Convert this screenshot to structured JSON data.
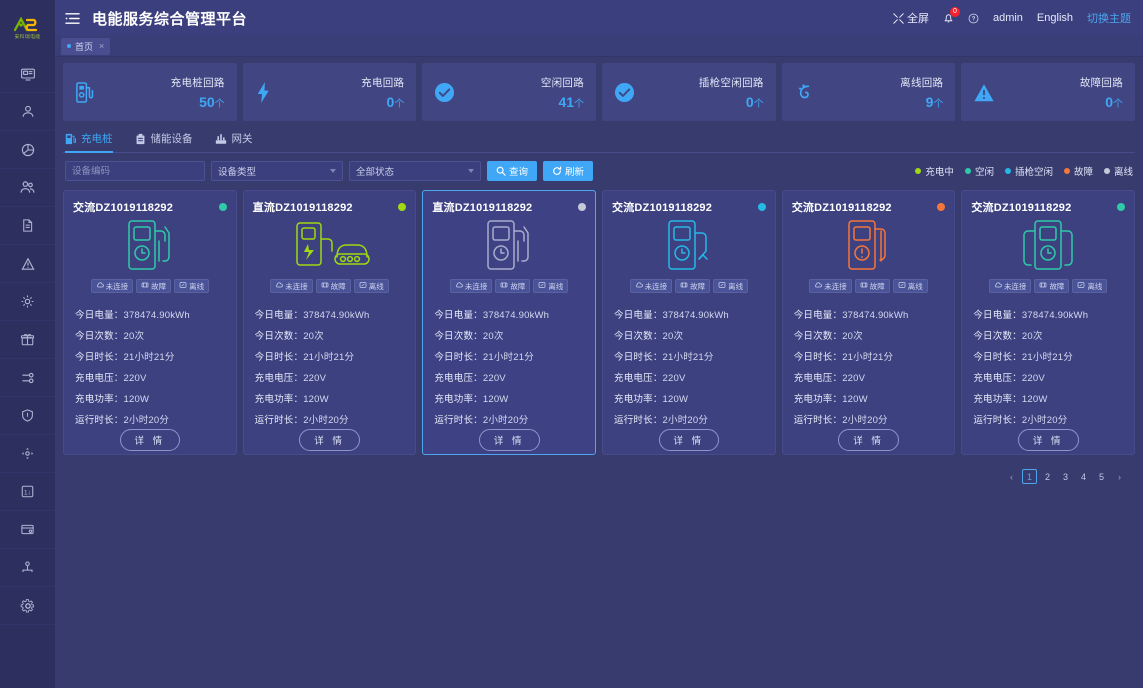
{
  "brand": {
    "logo_text": "AES",
    "logo_sub": "安科瑞电能",
    "accent": "#3fa7f5"
  },
  "header": {
    "menu_toggle_icon": "hamburger-icon",
    "title": "电能服务综合管理平台",
    "fullscreen_label": "全屏",
    "fullscreen_icon": "fullscreen-icon",
    "bell_icon": "bell-icon",
    "notification_count": "0",
    "help_icon": "help-circle-icon",
    "user": "admin",
    "language": "English",
    "theme_toggle": "切换主题"
  },
  "tabstrip": {
    "tabs": [
      {
        "label": "首页",
        "closable": true
      }
    ]
  },
  "stats": [
    {
      "icon": "charging-pile-icon",
      "label": "充电桩回路",
      "value": "50",
      "unit": "个"
    },
    {
      "icon": "bolt-icon",
      "label": "充电回路",
      "value": "0",
      "unit": "个"
    },
    {
      "icon": "check-circle-icon",
      "label": "空闲回路",
      "value": "41",
      "unit": "个"
    },
    {
      "icon": "check-circle-icon",
      "label": "插枪空闲回路",
      "value": "0",
      "unit": "个"
    },
    {
      "icon": "plug-icon",
      "label": "离线回路",
      "value": "9",
      "unit": "个"
    },
    {
      "icon": "warning-triangle-icon",
      "label": "故障回路",
      "value": "0",
      "unit": "个"
    }
  ],
  "tabs": [
    {
      "label": "充电桩",
      "icon": "charging-pile-icon",
      "active": true
    },
    {
      "label": "储能设备",
      "icon": "battery-icon",
      "active": false
    },
    {
      "label": "网关",
      "icon": "gateway-icon",
      "active": false
    }
  ],
  "filters": {
    "device_code_placeholder": "设备编码",
    "device_code_value": "",
    "device_type_value": "设备类型",
    "status_value": "全部状态",
    "search_label": "查询",
    "search_icon": "search-icon",
    "refresh_label": "刷新",
    "refresh_icon": "refresh-icon"
  },
  "legend": [
    {
      "label": "充电中",
      "color": "#a0d911"
    },
    {
      "label": "空闲",
      "color": "#2fcaa8"
    },
    {
      "label": "插枪空闲",
      "color": "#25b9e6"
    },
    {
      "label": "故障",
      "color": "#f5763b"
    },
    {
      "label": "离线",
      "color": "#c6cad8"
    }
  ],
  "card_field_labels": {
    "energy": "今日电量：",
    "count": "今日次数：",
    "duration": "今日时长：",
    "voltage": "充电电压：",
    "power": "充电功率：",
    "runtime": "运行时长："
  },
  "card_tags": [
    {
      "label": "未连接",
      "icon": "cloud-icon"
    },
    {
      "label": "故障",
      "icon": "gauge-icon"
    },
    {
      "label": "离线",
      "icon": "signal-off-icon"
    }
  ],
  "card_detail_label": "详 情",
  "cards": [
    {
      "title": "交流DZ1019118292",
      "type": "ac",
      "status_color": "#2fcaa8",
      "icon": "pile-ac-icon",
      "icon_color": "#2fcaa8",
      "energy": "378474.90kWh",
      "count": "20次",
      "duration": "21小时21分",
      "voltage": "220V",
      "power": "120W",
      "runtime": "2小时20分",
      "selected": false
    },
    {
      "title": "直流DZ1019118292",
      "type": "dc",
      "status_color": "#a0d911",
      "icon": "pile-dc-car-icon",
      "icon_color": "#a0d911",
      "energy": "378474.90kWh",
      "count": "20次",
      "duration": "21小时21分",
      "voltage": "220V",
      "power": "120W",
      "runtime": "2小时20分",
      "selected": false
    },
    {
      "title": "直流DZ1019118292",
      "type": "dc",
      "status_color": "#c6cad8",
      "icon": "pile-offline-icon",
      "icon_color": "#a8adcb",
      "energy": "378474.90kWh",
      "count": "20次",
      "duration": "21小时21分",
      "voltage": "220V",
      "power": "120W",
      "runtime": "2小时20分",
      "selected": true
    },
    {
      "title": "交流DZ1019118292",
      "type": "ac",
      "status_color": "#25b9e6",
      "icon": "pile-plugged-icon",
      "icon_color": "#25b9e6",
      "energy": "378474.90kWh",
      "count": "20次",
      "duration": "21小时21分",
      "voltage": "220V",
      "power": "120W",
      "runtime": "2小时20分",
      "selected": false
    },
    {
      "title": "交流DZ1019118292",
      "type": "ac",
      "status_color": "#f5763b",
      "icon": "pile-fault-icon",
      "icon_color": "#f5763b",
      "energy": "378474.90kWh",
      "count": "20次",
      "duration": "21小时21分",
      "voltage": "220V",
      "power": "120W",
      "runtime": "2小时20分",
      "selected": false
    },
    {
      "title": "交流DZ1019118292",
      "type": "ac",
      "status_color": "#2fcaa8",
      "icon": "pile-dual-icon",
      "icon_color": "#2fcaa8",
      "energy": "378474.90kWh",
      "count": "20次",
      "duration": "21小时21分",
      "voltage": "220V",
      "power": "120W",
      "runtime": "2小时20分",
      "selected": false
    }
  ],
  "pagination": {
    "prev": "‹",
    "next": "›",
    "pages": [
      "1",
      "2",
      "3",
      "4",
      "5"
    ],
    "current": "1"
  },
  "sidebar": {
    "items": [
      {
        "icon": "monitor-icon",
        "name": "sidebar-item-monitor"
      },
      {
        "icon": "person-icon",
        "name": "sidebar-item-person"
      },
      {
        "icon": "pie-chart-icon",
        "name": "sidebar-item-statistics"
      },
      {
        "icon": "users-icon",
        "name": "sidebar-item-users"
      },
      {
        "icon": "document-icon",
        "name": "sidebar-item-reports"
      },
      {
        "icon": "alarm-icon",
        "name": "sidebar-item-alarms"
      },
      {
        "icon": "settings-icon",
        "name": "sidebar-item-devices"
      },
      {
        "icon": "gift-icon",
        "name": "sidebar-item-marketing"
      },
      {
        "icon": "shuffle-icon",
        "name": "sidebar-item-dispatch"
      },
      {
        "icon": "shield-icon",
        "name": "sidebar-item-security"
      },
      {
        "icon": "move-icon",
        "name": "sidebar-item-control"
      },
      {
        "icon": "meter-icon",
        "name": "sidebar-item-meter"
      },
      {
        "icon": "card-icon",
        "name": "sidebar-item-billing"
      },
      {
        "icon": "org-icon",
        "name": "sidebar-item-organization"
      },
      {
        "icon": "gear-icon",
        "name": "sidebar-item-settings"
      }
    ]
  }
}
